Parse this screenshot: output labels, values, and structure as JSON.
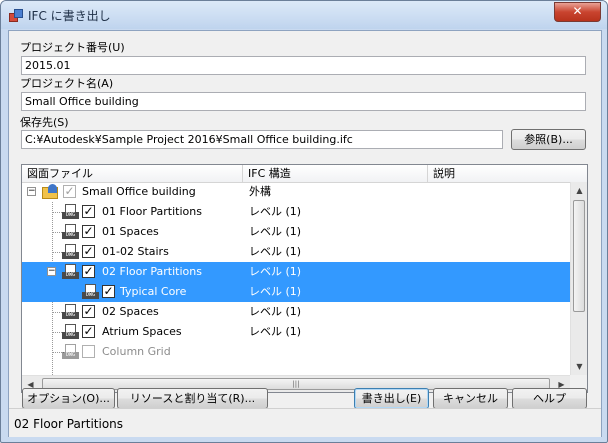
{
  "window": {
    "title": "IFC に書き出し",
    "close_glyph": "✕"
  },
  "fields": {
    "project_number_label": "プロジェクト番号(U)",
    "project_number_value": "2015.01",
    "project_name_label": "プロジェクト名(A)",
    "project_name_value": "Small Office building",
    "save_to_label": "保存先(S)",
    "save_to_value": "C:¥Autodesk¥Sample Project 2016¥Small Office building.ifc",
    "browse_button": "参照(B)..."
  },
  "tree": {
    "columns": [
      "図面ファイル",
      "IFC 構造",
      "説明"
    ],
    "rows": [
      {
        "name": "Small Office building",
        "ifc": "外構",
        "icon": "folder-icon",
        "checked": "checked-grey",
        "expander": "−"
      },
      {
        "name": "01 Floor Partitions",
        "ifc": "レベル (1)",
        "icon": "dwg-icon",
        "checked": "checked"
      },
      {
        "name": "01 Spaces",
        "ifc": "レベル (1)",
        "icon": "dwg-icon",
        "checked": "checked"
      },
      {
        "name": "01-02 Stairs",
        "ifc": "レベル (1)",
        "icon": "dwg-icon",
        "checked": "checked"
      },
      {
        "name": "02 Floor Partitions",
        "ifc": "レベル (1)",
        "icon": "dwg-icon",
        "checked": "checked",
        "expander": "−",
        "selected": true
      },
      {
        "name": "Typical Core",
        "ifc": "レベル (1)",
        "icon": "dwg-icon",
        "checked": "checked",
        "selected": true
      },
      {
        "name": "02 Spaces",
        "ifc": "レベル (1)",
        "icon": "dwg-icon",
        "checked": "checked"
      },
      {
        "name": "Atrium Spaces",
        "ifc": "レベル (1)",
        "icon": "dwg-icon",
        "checked": "checked"
      },
      {
        "name": "Column Grid",
        "ifc": "",
        "icon": "dwg-icon",
        "checked": "unchecked",
        "dim": true
      }
    ],
    "dwg_tag": "DWG",
    "scroll_up": "▲",
    "scroll_down": "▼",
    "scroll_left": "◀",
    "scroll_right": "▶",
    "grip": "|||"
  },
  "buttons": {
    "options": "オプション(O)...",
    "resources": "リソースと割り当て(R)...",
    "export": "書き出し(E)",
    "cancel": "キャンセル",
    "help": "ヘルプ"
  },
  "status": {
    "text": "02 Floor Partitions"
  },
  "colors": {
    "selection": "#3399ff",
    "title_bar": "#c9daf0",
    "close_button": "#c9442f"
  }
}
